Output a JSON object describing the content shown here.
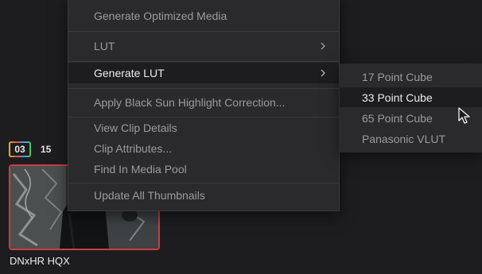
{
  "clip": {
    "track_badge": "03",
    "clip_number_partial": "15",
    "clip_name": "DNxHR HQX",
    "selected_border_color": "#c9403f"
  },
  "context_menu": {
    "items": [
      {
        "label": "Generate Optimized Media",
        "has_submenu": false,
        "highlighted": false
      },
      {
        "label": "LUT",
        "has_submenu": true,
        "highlighted": false
      },
      {
        "label": "Generate LUT",
        "has_submenu": true,
        "highlighted": true
      },
      {
        "label": "Apply Black Sun Highlight Correction...",
        "has_submenu": false,
        "highlighted": false
      },
      {
        "label": "View Clip Details",
        "has_submenu": false,
        "highlighted": false
      },
      {
        "label": "Clip Attributes...",
        "has_submenu": false,
        "highlighted": false
      },
      {
        "label": "Find In Media Pool",
        "has_submenu": false,
        "highlighted": false
      },
      {
        "label": "Update All Thumbnails",
        "has_submenu": false,
        "highlighted": false
      }
    ],
    "submenu_icon": "chevron-right-icon"
  },
  "submenu": {
    "items": [
      {
        "label": "17 Point Cube",
        "highlighted": false
      },
      {
        "label": "33 Point Cube",
        "highlighted": true
      },
      {
        "label": "65 Point Cube",
        "highlighted": false
      },
      {
        "label": "Panasonic VLUT",
        "highlighted": false
      }
    ]
  },
  "cursor_icon": "mouse-pointer-icon"
}
